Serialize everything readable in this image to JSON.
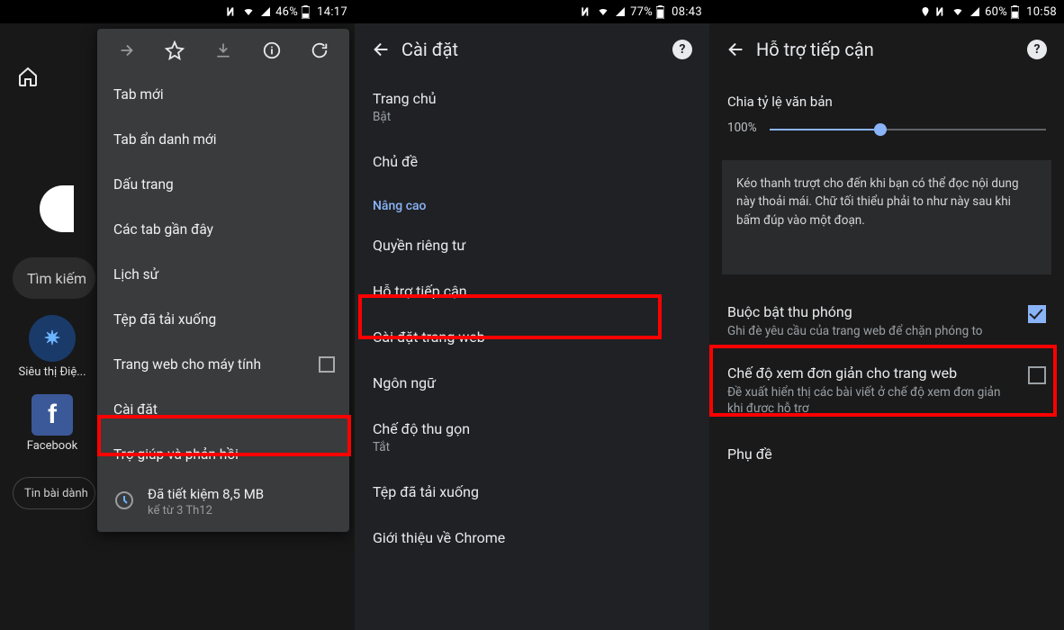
{
  "panel1": {
    "status": {
      "battery": "46%",
      "time": "14:17"
    },
    "search_placeholder": "Tìm kiếm",
    "site1_label": "Siêu thị Điệ...",
    "site2_label": "Facebook",
    "chip": "Tin bài dành",
    "menu": {
      "items": [
        "Tab mới",
        "Tab ẩn danh mới",
        "Dấu trang",
        "Các tab gần đây",
        "Lịch sử",
        "Tệp đã tải xuống",
        "Trang web cho máy tính",
        "Cài đặt",
        "Trợ giúp và phản hồi"
      ],
      "data_saved_line1": "Đã tiết kiệm 8,5 MB",
      "data_saved_line2": "kể từ 3 Th12"
    }
  },
  "panel2": {
    "status": {
      "battery": "77%",
      "time": "08:43"
    },
    "title": "Cài đặt",
    "rows": {
      "home": "Trang chủ",
      "home_sub": "Bật",
      "theme": "Chủ đề",
      "advanced": "Nâng cao",
      "privacy": "Quyền riêng tư",
      "access": "Hỗ trợ tiếp cận",
      "site": "Cài đặt trang web",
      "lang": "Ngôn ngữ",
      "lite": "Chế độ thu gọn",
      "lite_sub": "Tắt",
      "downloads": "Tệp đã tải xuống",
      "about": "Giới thiệu về Chrome"
    }
  },
  "panel3": {
    "status": {
      "battery": "60%",
      "time": "10:58"
    },
    "title": "Hỗ trợ tiếp cận",
    "scale_label": "Chia tỷ lệ văn bản",
    "scale_value": "100%",
    "sample": "Kéo thanh trượt cho đến khi bạn có thể đọc nội dung này thoải mái. Chữ tối thiểu phải to như này sau khi bấm đúp vào một đoạn.",
    "zoom_title": "Buộc bật thu phóng",
    "zoom_sub": "Ghi đè yêu cầu của trang web để chặn phóng to",
    "simple_title": "Chế độ xem đơn giản cho trang web",
    "simple_sub": "Đề xuất hiển thị các bài viết ở chế độ xem đơn giản khi được hỗ trợ",
    "captions": "Phụ đề"
  }
}
